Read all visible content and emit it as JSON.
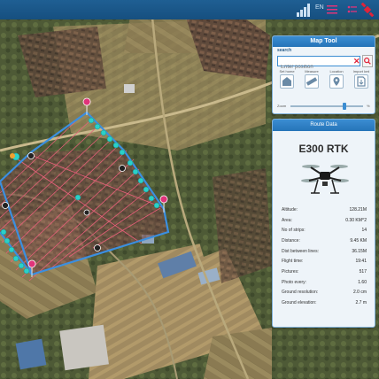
{
  "topbar": {
    "lang": "EN"
  },
  "map_tool": {
    "title": "Map Tool",
    "search_label": "search",
    "search_placeholder": "Enter position",
    "tools": [
      {
        "label": "Set home",
        "icon": "home-marker-icon"
      },
      {
        "label": "Measure",
        "icon": "ruler-icon"
      },
      {
        "label": "Location",
        "icon": "location-pin-icon"
      },
      {
        "label": "Import kml",
        "icon": "import-file-icon"
      }
    ],
    "zoom_label": "Zoom",
    "zoom_value": "%",
    "zoom_fraction": 0.76
  },
  "route_data": {
    "title": "Route Data",
    "model": "E300 RTK",
    "stats": [
      {
        "label": "Altitude:",
        "value": "128.21M"
      },
      {
        "label": "Area:",
        "value": "0.30 KM^2"
      },
      {
        "label": "No of strips:",
        "value": "14"
      },
      {
        "label": "Distance:",
        "value": "9.45 KM"
      },
      {
        "label": "Dist between lines:",
        "value": "36.15M"
      },
      {
        "label": "Flight time:",
        "value": "19:41"
      },
      {
        "label": "Pictures:",
        "value": "517"
      },
      {
        "label": "Photo every:",
        "value": "1.60"
      },
      {
        "label": "Ground resolution:",
        "value": "2.0 cm"
      },
      {
        "label": "Ground elevation:",
        "value": "2.7 m"
      }
    ]
  },
  "colors": {
    "header_blue": "#2574b8",
    "route_line": "#3b8fe0",
    "flight_path": "#e8607a",
    "waypoint": "#2bd0c8",
    "marker_pink": "#e0347a"
  }
}
